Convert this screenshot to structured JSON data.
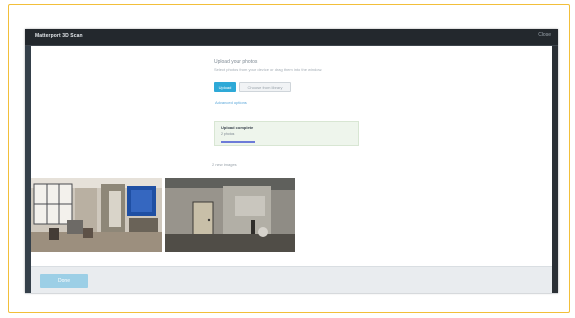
{
  "modal": {
    "title": "Matterport 3D Scan",
    "close_label": "Close",
    "section_heading": "Upload your photos",
    "section_description": "Select photos from your device or drag them into the window.",
    "primary_button_label": "Upload",
    "secondary_button_label": "Choose from library",
    "link_label": "Advanced options",
    "status_card": {
      "title": "Upload complete",
      "subtitle": "2 photos",
      "progress": 0.26
    },
    "photos_label": "2 new images",
    "photos": [
      {
        "description": "hallway-interior"
      },
      {
        "description": "room-interior-door"
      }
    ],
    "footer_button_label": "Done"
  },
  "colors": {
    "frame_border": "#f2bf3a",
    "app_dark": "#2b3036",
    "primary": "#2ea9d7",
    "footer_button": "#9ccfe6",
    "status_card_bg": "#eef5ec",
    "status_bar": "#6d7bd8"
  }
}
